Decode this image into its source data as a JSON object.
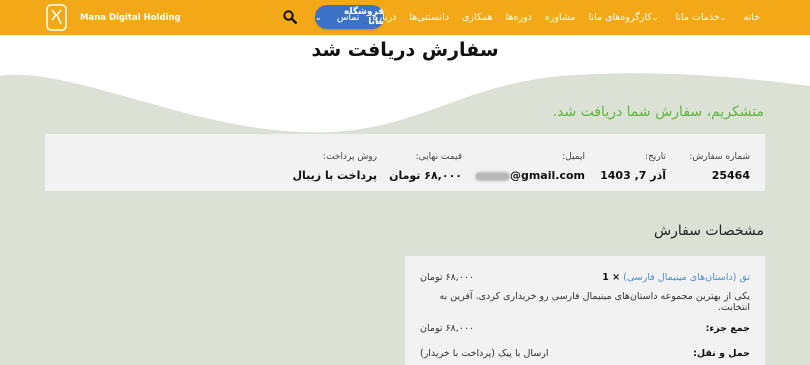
{
  "nav": {
    "items": [
      {
        "label": "خانه",
        "caret": false
      },
      {
        "label": "خدمات مانا",
        "caret": true
      },
      {
        "label": "کارگروه‌های مانا",
        "caret": true
      },
      {
        "label": "مشاوره",
        "caret": false
      },
      {
        "label": "دوره‌ها",
        "caret": false
      },
      {
        "label": "همکاری",
        "caret": false
      },
      {
        "label": "دانستنی‌ها",
        "caret": false
      },
      {
        "label": "درباره",
        "caret": false
      },
      {
        "label": "تماس",
        "caret": false
      }
    ],
    "shop_button": "فروشگاه مانا",
    "brand": "Mana Digital Holding"
  },
  "page": {
    "title": "سفارش دریافت شد",
    "thanks": "متشکریم، سفارش شما دریافت شد."
  },
  "order": {
    "number_label": "شماره سفارش:",
    "number": "25464",
    "date_label": "تاریخ:",
    "date": "آذر 7, 1403",
    "email_label": "ایمیل:",
    "email_suffix": "@gmail.com",
    "total_label": "قیمت نهایی:",
    "total": "۶۸,۰۰۰ تومان",
    "payment_label": "روش پرداخت:",
    "payment": "پرداخت با زیبال"
  },
  "details": {
    "title": "مشخصات سفارش",
    "product": "تق (داستان‌های مینیمال فارسی)",
    "qty": "× 1",
    "product_price": "۶۸,۰۰۰ تومان",
    "note": "یکی از بهترین مجموعه داستان‌های مینیمال فارسی رو خریداری کردی. آفرین به انتخابت.",
    "subtotal_label": "جمع جزء:",
    "subtotal": "۶۸,۰۰۰ تومان",
    "shipping_label": "حمل و نقل:",
    "shipping": "ارسال با پیک (پرداخت با خریدار)"
  },
  "colors": {
    "navbar": "#f3a917",
    "shop_button": "#3d73c6",
    "thanks_text": "#5fb63e",
    "product_link": "#4d8fd1"
  }
}
